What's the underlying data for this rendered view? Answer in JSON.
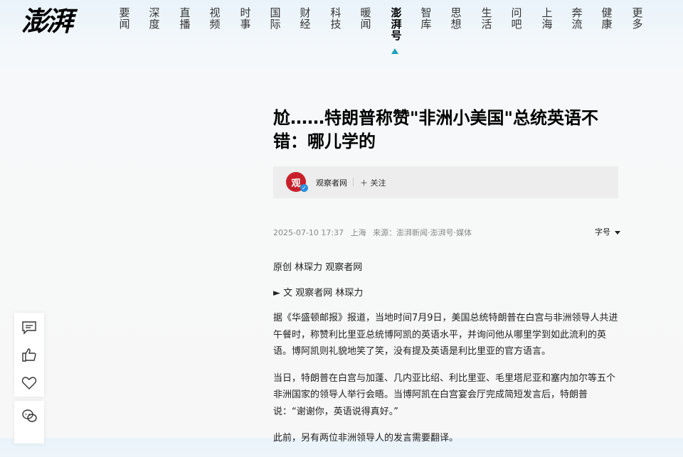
{
  "logo": "澎湃",
  "nav": {
    "items": [
      "要闻",
      "深度",
      "直播",
      "视频",
      "时事",
      "国际",
      "财经",
      "科技",
      "暖闻",
      "澎湃号",
      "智库",
      "思想",
      "生活",
      "问吧",
      "上海",
      "奔流",
      "健康",
      "更多"
    ],
    "active_index": 9,
    "active_color": "#1aa3b8"
  },
  "article": {
    "title": "尬……特朗普称赞\"非洲小美国\"总统英语不错：哪儿学的",
    "author": {
      "avatar_text": "观",
      "name": "观察者网",
      "follow_label": "关注"
    },
    "meta": {
      "datetime": "2025-07-10 17:37",
      "location": "上海",
      "source": "来源：澎湃新闻·澎湃号·媒体"
    },
    "font_size_label": "字号",
    "paragraphs": [
      "原创 林琛力 观察者网",
      "► 文 观察者网 林琛力",
      "据《华盛顿邮报》报道，当地时间7月9日，美国总统特朗普在白宫与非洲领导人共进午餐时，称赞利比里亚总统博阿凯的英语水平，并询问他从哪里学到如此流利的英语。博阿凯则礼貌地笑了笑，没有提及英语是利比里亚的官方语言。",
      "当日，特朗普在白宫与加蓬、几内亚比绍、利比里亚、毛里塔尼亚和塞内加尔等五个非洲国家的领导人举行会晤。当博阿凯在白宫宴会厅完成简短发言后，特朗普说：“谢谢你，英语说得真好。”",
      "此前，另有两位非洲领导人的发言需要翻译。"
    ]
  },
  "sidebar": {
    "icons": [
      "comment-icon",
      "thumbs-up-icon",
      "heart-icon",
      "share-icon"
    ]
  }
}
